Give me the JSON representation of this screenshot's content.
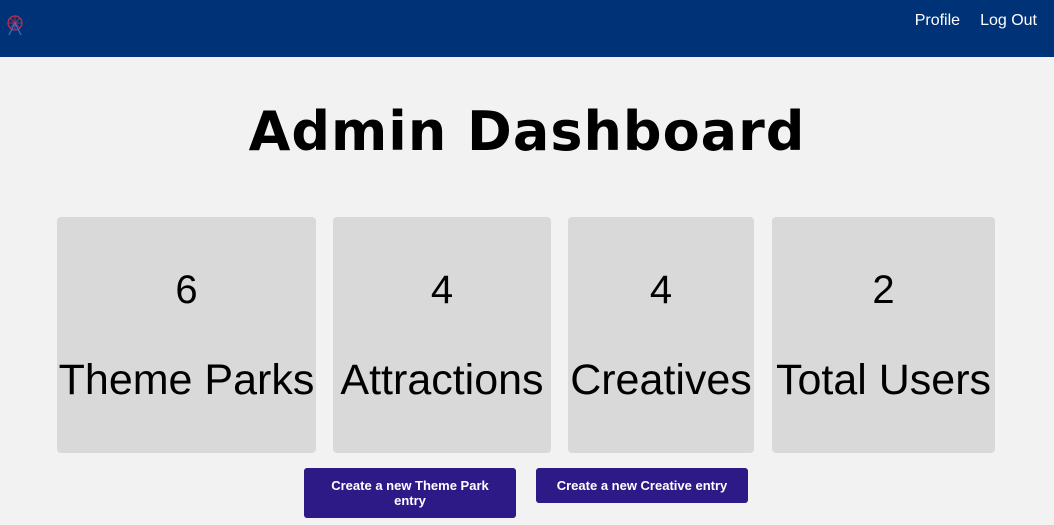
{
  "nav": {
    "profile": "Profile",
    "logout": "Log Out"
  },
  "page": {
    "title": "Admin Dashboard"
  },
  "stats": [
    {
      "value": "6",
      "label": "Theme Parks"
    },
    {
      "value": "4",
      "label": "Attractions"
    },
    {
      "value": "4",
      "label": "Creatives"
    },
    {
      "value": "2",
      "label": "Total Users"
    }
  ],
  "actions": {
    "create_theme_park": "Create a new Theme Park entry",
    "create_creative": "Create a new Creative entry"
  },
  "colors": {
    "navbar": "#003278",
    "button": "#2e1a87",
    "card": "#d9d9d9",
    "background": "#f2f2f2"
  },
  "icons": {
    "logo": "ferris-wheel-icon"
  }
}
